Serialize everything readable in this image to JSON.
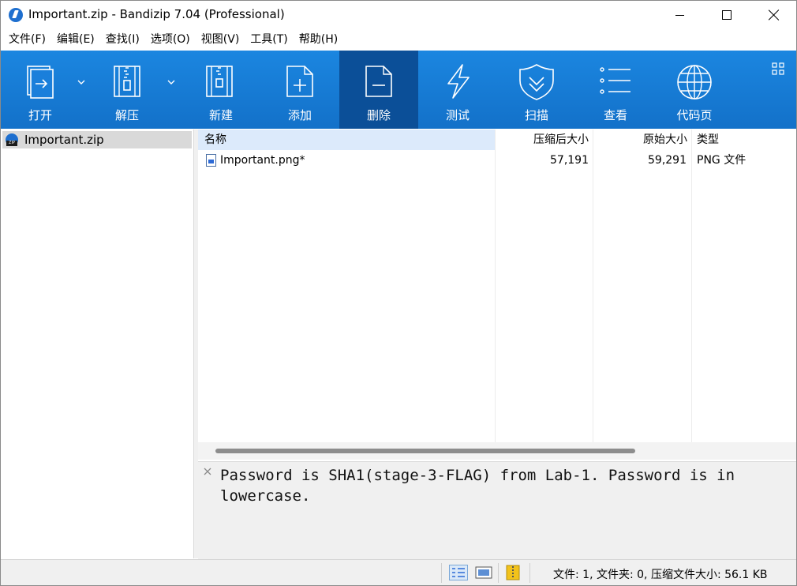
{
  "window": {
    "title": "Important.zip - Bandizip 7.04 (Professional)"
  },
  "menu": [
    "文件(F)",
    "编辑(E)",
    "查找(I)",
    "选项(O)",
    "视图(V)",
    "工具(T)",
    "帮助(H)"
  ],
  "toolbar": {
    "open": "打开",
    "extract": "解压",
    "new": "新建",
    "add": "添加",
    "delete": "删除",
    "test": "测试",
    "scan": "扫描",
    "view": "查看",
    "codepage": "代码页",
    "active_button": "delete"
  },
  "tree": {
    "item": "Important.zip",
    "zip_badge": "ZIP"
  },
  "columns": {
    "name": "名称",
    "packed": "压缩后大小",
    "original": "原始大小",
    "type": "类型"
  },
  "files": [
    {
      "name": "Important.png*",
      "packed": "57,191",
      "original": "59,291",
      "type": "PNG 文件"
    }
  ],
  "comment": "Password is SHA1(stage-3-FLAG) from Lab-1. Password is in lowercase.",
  "status": {
    "text": "文件: 1, 文件夹: 0, 压缩文件大小: 56.1 KB"
  },
  "colors": {
    "toolbar": "#1677d6",
    "toolbar_active": "#0b4f98",
    "selection": "#dceafb"
  }
}
